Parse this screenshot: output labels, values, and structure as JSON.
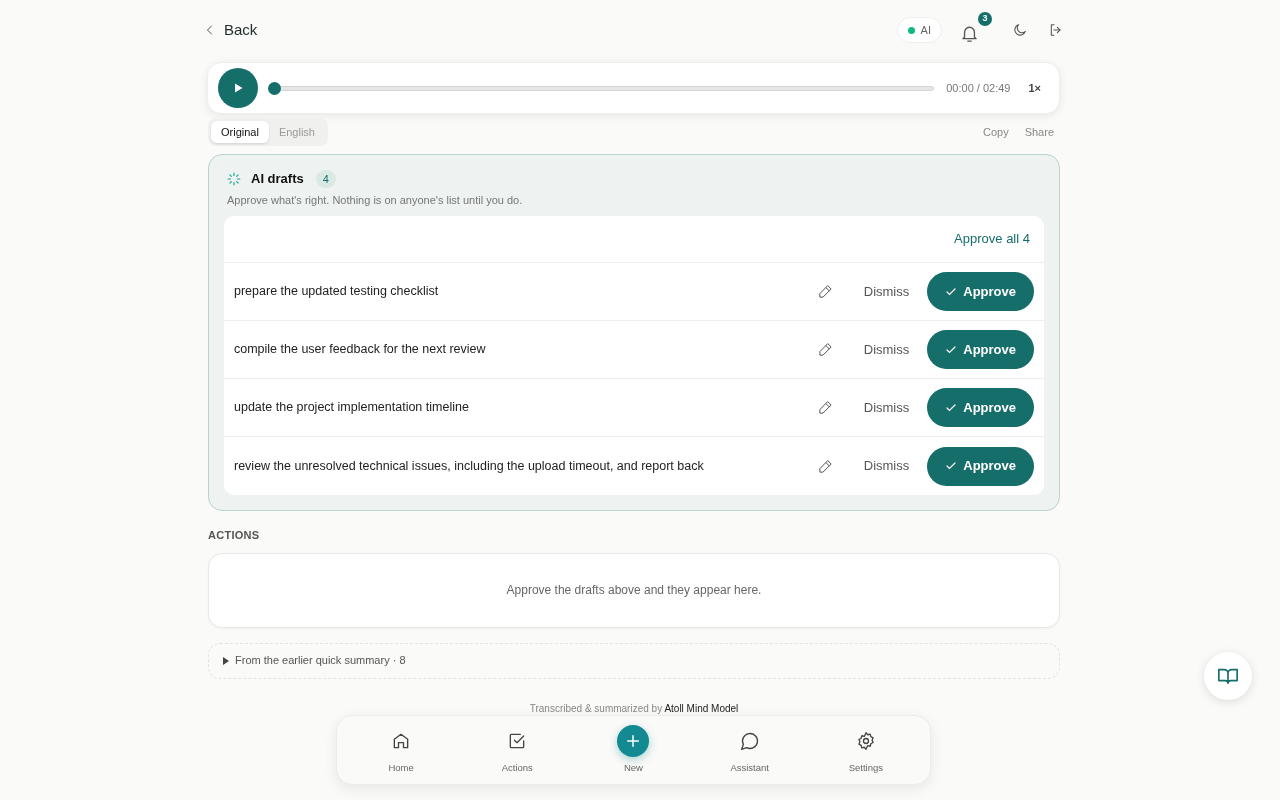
{
  "header": {
    "back": "Back",
    "ai_badge": {
      "label": "AI",
      "color": "#10b981"
    },
    "notifications": "3"
  },
  "player": {
    "level": 0,
    "time": "00:00 / 02:49",
    "speed": "1×"
  },
  "transcript_tabs": [
    {
      "label": "Original",
      "selected": true
    },
    {
      "label": "English",
      "selected": false
    }
  ],
  "transcript_actions": [
    "Copy",
    "Share"
  ],
  "drafts": {
    "title": "AI drafts",
    "count": "4",
    "subtitle": "Approve what's right. Nothing is on anyone's list until you do.",
    "approve_all": "Approve all 4",
    "items": [
      {
        "text": "prepare the updated testing checklist",
        "dismiss": "Dismiss",
        "approve": "Approve"
      },
      {
        "text": "compile the user feedback for the next review",
        "dismiss": "Dismiss",
        "approve": "Approve"
      },
      {
        "text": "update the project implementation timeline",
        "dismiss": "Dismiss",
        "approve": "Approve"
      },
      {
        "text": "review the unresolved technical issues, including the upload timeout, and report back",
        "dismiss": "Dismiss",
        "approve": "Approve"
      }
    ]
  },
  "actions": {
    "heading": "ACTIONS",
    "empty": "Approve the drafts above and they appear here."
  },
  "earlier": {
    "label": "From the earlier quick summary · 8",
    "expanded": false
  },
  "footer": "Transcribed & summarized by **Atoll Mind Model**",
  "nav": [
    {
      "label": "Home",
      "kind": "home"
    },
    {
      "label": "Actions",
      "kind": "actions"
    },
    {
      "label": "New",
      "kind": "new"
    },
    {
      "label": "Assistant",
      "kind": "assistant"
    },
    {
      "label": "Settings",
      "kind": "settings"
    }
  ]
}
